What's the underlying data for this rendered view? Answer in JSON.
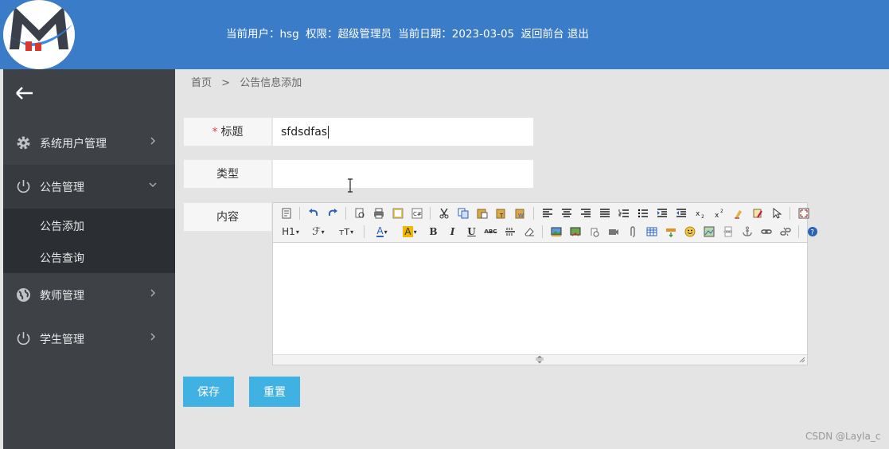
{
  "header": {
    "user_label": "当前用户：hsg",
    "role_label": "权限：超级管理员",
    "date_label": "当前日期：2023-03-05",
    "back_link": "返回前台",
    "logout_link": "退出",
    "colors": {
      "header_bg": "#3a7cc7",
      "sidebar_bg": "#3e4247",
      "accent": "#3fb1e3"
    }
  },
  "sidebar": {
    "items": [
      {
        "label": "系统用户管理",
        "icon": "gear-icon"
      },
      {
        "label": "公告管理",
        "icon": "power-icon",
        "expanded": true,
        "children": [
          {
            "label": "公告添加"
          },
          {
            "label": "公告查询"
          }
        ]
      },
      {
        "label": "教师管理",
        "icon": "globe-icon"
      },
      {
        "label": "学生管理",
        "icon": "power-icon"
      }
    ]
  },
  "breadcrumb": {
    "home": "首页",
    "separator": ">",
    "current": "公告信息添加"
  },
  "form": {
    "title": {
      "label": "标题",
      "required_mark": "*",
      "value": "sfdsdfas"
    },
    "type": {
      "label": "类型",
      "value": ""
    },
    "content": {
      "label": "内容"
    },
    "toolbar": {
      "heading": "H1",
      "heading_suffix": "▾",
      "font_family": "ℱ",
      "font_size": "ᴛT",
      "font_color": "A",
      "bg_color": "A",
      "bold": "B",
      "italic": "I",
      "underline": "U",
      "strike": "ABC"
    },
    "save_button": "保存",
    "reset_button": "重置"
  },
  "watermark": "CSDN @Layla_c"
}
